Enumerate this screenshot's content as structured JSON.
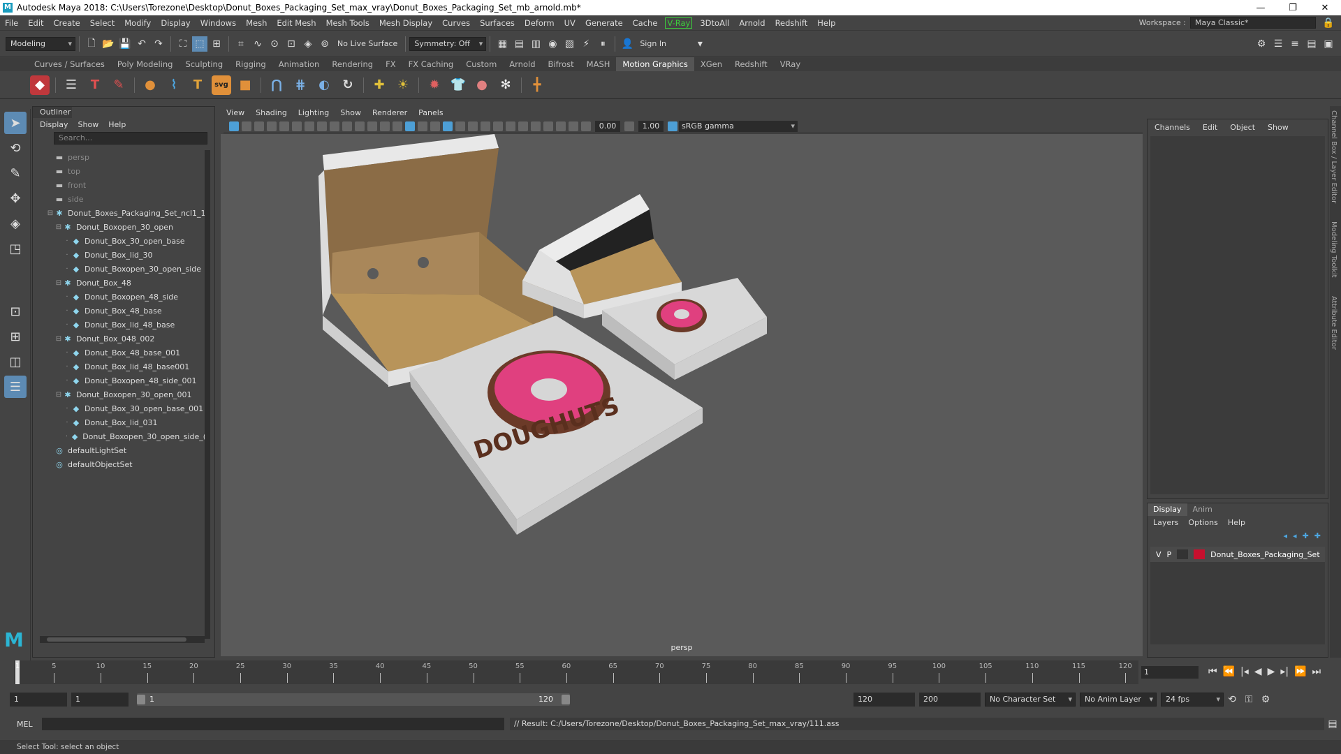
{
  "window": {
    "title": "Autodesk Maya 2018: C:\\Users\\Torezone\\Desktop\\Donut_Boxes_Packaging_Set_max_vray\\Donut_Boxes_Packaging_Set_mb_arnold.mb*",
    "minimize": "—",
    "maximize": "❐",
    "close": "✕"
  },
  "menubar": {
    "items": [
      "File",
      "Edit",
      "Create",
      "Select",
      "Modify",
      "Display",
      "Windows",
      "Mesh",
      "Edit Mesh",
      "Mesh Tools",
      "Mesh Display",
      "Curves",
      "Surfaces",
      "Deform",
      "UV",
      "Generate",
      "Cache"
    ],
    "vray": "V-Ray",
    "items2": [
      "3DtoAll",
      "Arnold",
      "Redshift",
      "Help"
    ],
    "workspace_label": "Workspace :",
    "workspace_value": "Maya Classic*"
  },
  "statusline": {
    "mode": "Modeling",
    "live_surface": "No Live Surface",
    "symmetry": "Symmetry: Off",
    "sign_in": "Sign In"
  },
  "shelf": {
    "tabs": [
      "Curves / Surfaces",
      "Poly Modeling",
      "Sculpting",
      "Rigging",
      "Animation",
      "Rendering",
      "FX",
      "FX Caching",
      "Custom",
      "Arnold",
      "Bifrost",
      "MASH",
      "Motion Graphics",
      "XGen",
      "Redshift",
      "VRay"
    ],
    "active_tab": "Motion Graphics"
  },
  "outliner": {
    "title": "Outliner",
    "menu": [
      "Display",
      "Show",
      "Help"
    ],
    "search_placeholder": "Search...",
    "rows": [
      {
        "label": "persp",
        "type": "camera",
        "indent": 0
      },
      {
        "label": "top",
        "type": "camera",
        "indent": 0
      },
      {
        "label": "front",
        "type": "camera",
        "indent": 0
      },
      {
        "label": "side",
        "type": "camera",
        "indent": 0
      },
      {
        "label": "Donut_Boxes_Packaging_Set_ncl1_1",
        "type": "group",
        "indent": 0
      },
      {
        "label": "Donut_Boxopen_30_open",
        "type": "group",
        "indent": 1
      },
      {
        "label": "Donut_Box_30_open_base",
        "type": "mesh",
        "indent": 2
      },
      {
        "label": "Donut_Box_lid_30",
        "type": "mesh",
        "indent": 2
      },
      {
        "label": "Donut_Boxopen_30_open_side",
        "type": "mesh",
        "indent": 2
      },
      {
        "label": "Donut_Box_48",
        "type": "group",
        "indent": 1
      },
      {
        "label": "Donut_Boxopen_48_side",
        "type": "mesh",
        "indent": 2
      },
      {
        "label": "Donut_Box_48_base",
        "type": "mesh",
        "indent": 2
      },
      {
        "label": "Donut_Box_lid_48_base",
        "type": "mesh",
        "indent": 2
      },
      {
        "label": "Donut_Box_048_002",
        "type": "group",
        "indent": 1
      },
      {
        "label": "Donut_Box_48_base_001",
        "type": "mesh",
        "indent": 2
      },
      {
        "label": "Donut_Box_lid_48_base001",
        "type": "mesh",
        "indent": 2
      },
      {
        "label": "Donut_Boxopen_48_side_001",
        "type": "mesh",
        "indent": 2
      },
      {
        "label": "Donut_Boxopen_30_open_001",
        "type": "group",
        "indent": 1
      },
      {
        "label": "Donut_Box_30_open_base_001",
        "type": "mesh",
        "indent": 2
      },
      {
        "label": "Donut_Box_lid_031",
        "type": "mesh",
        "indent": 2
      },
      {
        "label": "Donut_Boxopen_30_open_side_(",
        "type": "mesh",
        "indent": 2
      },
      {
        "label": "defaultLightSet",
        "type": "set",
        "indent": 0
      },
      {
        "label": "defaultObjectSet",
        "type": "set",
        "indent": 0
      }
    ]
  },
  "viewport": {
    "menu": [
      "View",
      "Shading",
      "Lighting",
      "Show",
      "Renderer",
      "Panels"
    ],
    "exposure": "0.00",
    "gamma": "1.00",
    "color_space": "sRGB gamma",
    "camera_label": "persp",
    "logo_text": "DOUGHUTS"
  },
  "channelbox": {
    "menu": [
      "Channels",
      "Edit",
      "Object",
      "Show"
    ],
    "side_tabs": [
      "Channel Box / Layer Editor",
      "Modeling Toolkit",
      "Attribute Editor"
    ]
  },
  "layer_editor": {
    "tabs": [
      "Display",
      "Anim"
    ],
    "menu": [
      "Layers",
      "Options",
      "Help"
    ],
    "layer": {
      "v": "V",
      "p": "P",
      "name": "Donut_Boxes_Packaging_Set",
      "color": "#c8102e"
    }
  },
  "timeline": {
    "labels": [
      "5",
      "10",
      "15",
      "20",
      "25",
      "30",
      "35",
      "40",
      "45",
      "50",
      "55",
      "60",
      "65",
      "70",
      "75",
      "80",
      "85",
      "90",
      "95",
      "100",
      "105",
      "110",
      "115",
      "120"
    ],
    "current_frame_marker": "1",
    "current_frame": "1"
  },
  "range": {
    "start": "1",
    "playback_start": "1",
    "bar_start": "1",
    "bar_end": "120",
    "playback_end": "120",
    "end": "200",
    "character_set": "No Character Set",
    "anim_layer": "No Anim Layer",
    "fps": "24 fps"
  },
  "command": {
    "language": "MEL",
    "result": "// Result: C:/Users/Torezone/Desktop/Donut_Boxes_Packaging_Set_max_vray/111.ass"
  },
  "helpline": "Select Tool: select an object",
  "colors": {
    "accent": "#5d8bb4",
    "vray_green": "#3ccf3c",
    "viewport_bg": "#5a5a5a"
  }
}
